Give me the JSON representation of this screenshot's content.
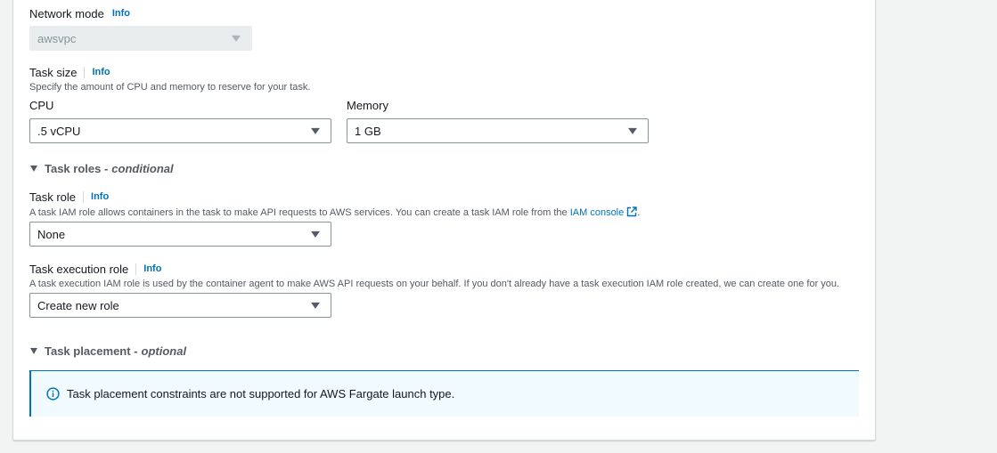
{
  "network_mode": {
    "label": "Network mode",
    "info": "Info",
    "value": "awsvpc"
  },
  "task_size": {
    "label": "Task size",
    "info": "Info",
    "description": "Specify the amount of CPU and memory to reserve for your task.",
    "cpu_label": "CPU",
    "cpu_value": ".5 vCPU",
    "memory_label": "Memory",
    "memory_value": "1 GB"
  },
  "task_roles_section": {
    "title": "Task roles -",
    "qualifier": "conditional"
  },
  "task_role": {
    "label": "Task role",
    "info": "Info",
    "description": "A task IAM role allows containers in the task to make API requests to AWS services. You can create a task IAM role from the",
    "link": "IAM console",
    "suffix": ".",
    "value": "None"
  },
  "task_execution_role": {
    "label": "Task execution role",
    "info": "Info",
    "description": "A task execution IAM role is used by the container agent to make AWS API requests on your behalf. If you don't already have a task execution IAM role created, we can create one for you.",
    "value": "Create new role"
  },
  "task_placement_section": {
    "title": "Task placement -",
    "qualifier": "optional",
    "alert": "Task placement constraints are not supported for AWS Fargate launch type."
  },
  "colors": {
    "link": "#0073bb",
    "alert_bg": "#f1faff",
    "border": "#879596"
  }
}
